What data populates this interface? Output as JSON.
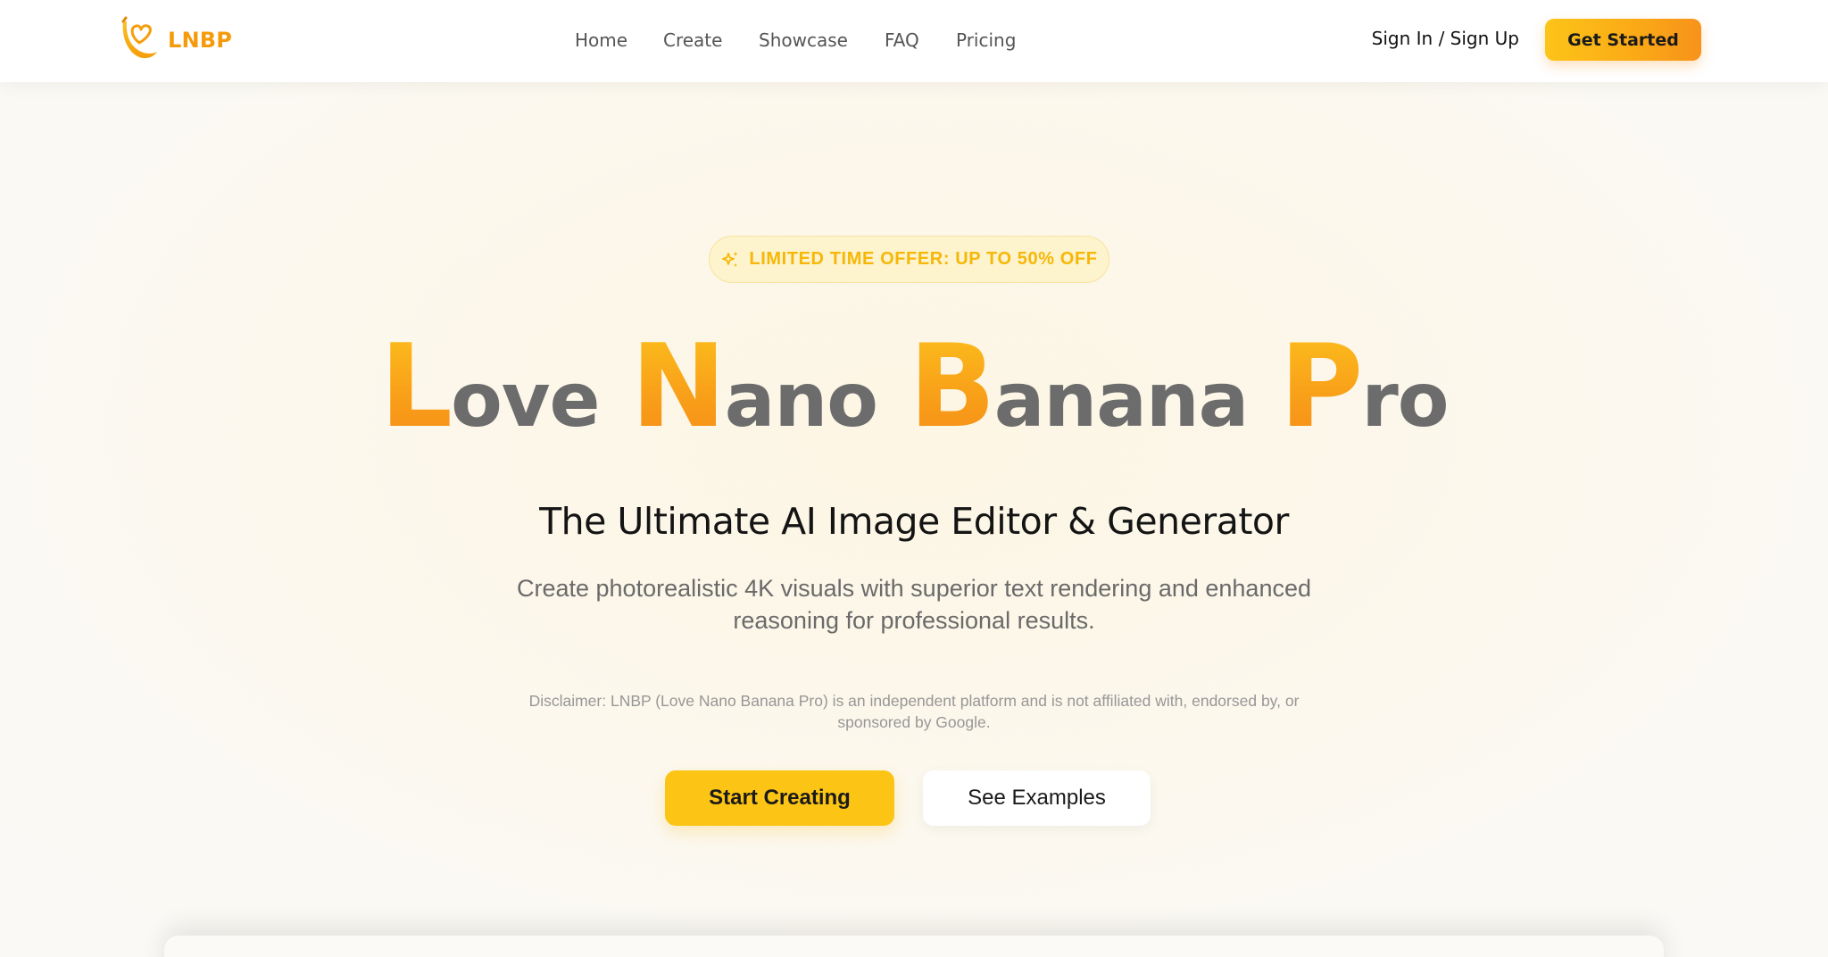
{
  "header": {
    "brand": "LNBP",
    "logo_icon": "banana-heart-icon",
    "nav": [
      {
        "label": "Home"
      },
      {
        "label": "Create"
      },
      {
        "label": "Showcase"
      },
      {
        "label": "FAQ"
      },
      {
        "label": "Pricing"
      }
    ],
    "sign_in_label": "Sign In / Sign Up",
    "get_started_label": "Get Started"
  },
  "hero": {
    "offer_badge": {
      "icon": "sparkle-icon",
      "text": "LIMITED TIME OFFER: UP TO 50% OFF"
    },
    "title_words": [
      {
        "cap": "L",
        "rest": "ove"
      },
      {
        "cap": "N",
        "rest": "ano"
      },
      {
        "cap": "B",
        "rest": "anana"
      },
      {
        "cap": "P",
        "rest": "ro"
      }
    ],
    "subtitle": "The Ultimate AI Image Editor & Generator",
    "description": "Create photorealistic 4K visuals with superior text rendering and enhanced reasoning for professional results.",
    "disclaimer": "Disclaimer: LNBP (Love Nano Banana Pro) is an independent platform and is not affiliated with, endorsed by, or sponsored by Google.",
    "primary_cta": "Start Creating",
    "secondary_cta": "See Examples"
  },
  "colors": {
    "brand_orange": "#f59b0b",
    "accent_yellow": "#fcc414",
    "title_gray": "#6c6c6c"
  }
}
